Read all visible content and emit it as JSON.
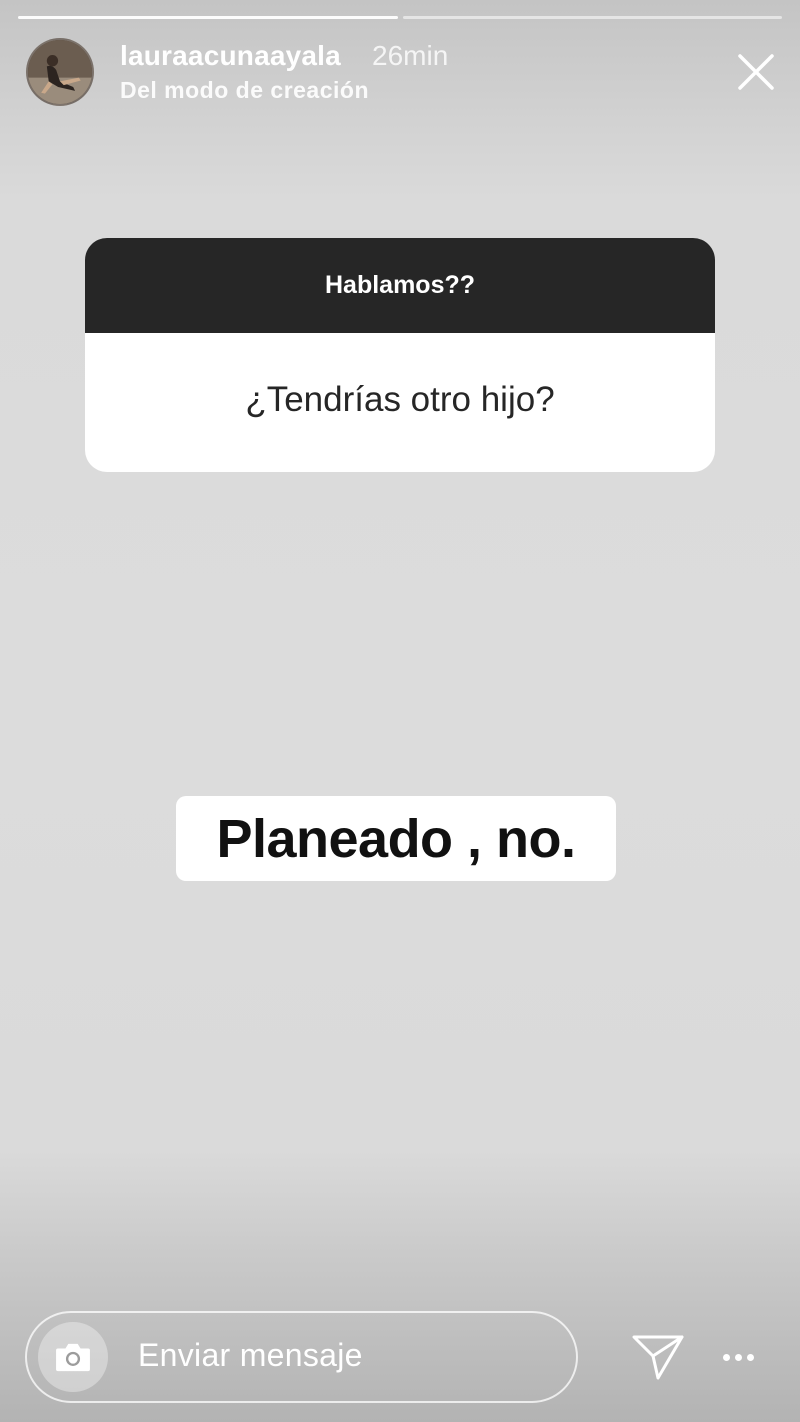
{
  "story": {
    "progress_segments": [
      {
        "state": "done"
      },
      {
        "state": "pending"
      }
    ],
    "header": {
      "username": "lauraacunaayala",
      "time_ago": "26min",
      "subtitle": "Del modo de creación",
      "close_icon": "close-icon"
    },
    "question_sticker": {
      "prompt": "Hablamos??",
      "question": "¿Tendrías otro hijo?",
      "header_color": "#262626"
    },
    "answer_text": "Planeado , no.",
    "footer": {
      "message_placeholder": "Enviar mensaje",
      "camera_icon": "camera-icon",
      "send_icon": "send-icon",
      "more_icon": "more-icon"
    }
  }
}
